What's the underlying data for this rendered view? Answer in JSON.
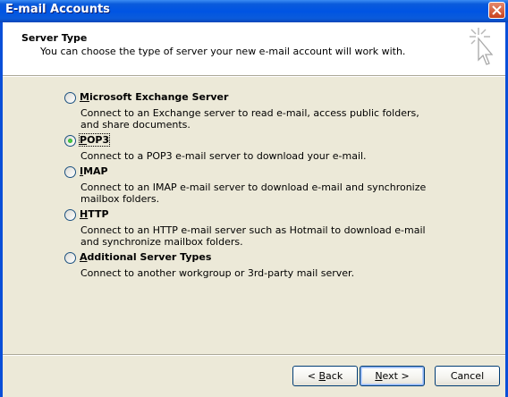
{
  "window": {
    "title": "E-mail Accounts"
  },
  "header": {
    "title": "Server Type",
    "subtitle": "You can choose the type of server your new e-mail account will work with."
  },
  "options": [
    {
      "label_first": "M",
      "label_rest": "icrosoft Exchange Server",
      "description": "Connect to an Exchange server to read e-mail, access public folders, and share documents.",
      "selected": false
    },
    {
      "label_first": "P",
      "label_rest": "OP3",
      "description": "Connect to a POP3 e-mail server to download your e-mail.",
      "selected": true
    },
    {
      "label_first": "I",
      "label_rest": "MAP",
      "description": "Connect to an IMAP e-mail server to download e-mail and synchronize mailbox folders.",
      "selected": false
    },
    {
      "label_first": "H",
      "label_rest": "TTP",
      "description": "Connect to an HTTP e-mail server such as Hotmail to download e-mail and synchronize mailbox folders.",
      "selected": false
    },
    {
      "label_first": "A",
      "label_rest": "dditional Server Types",
      "description": "Connect to another workgroup or 3rd-party mail server.",
      "selected": false
    }
  ],
  "buttons": {
    "back_prefix": "< ",
    "back_mnemonic": "B",
    "back_rest": "ack",
    "next_mnemonic": "N",
    "next_rest": "ext >",
    "cancel": "Cancel"
  },
  "icons": {
    "close": "close-icon",
    "wizard": "cursor-sparkle-icon"
  },
  "colors": {
    "titlebar": "#0054E3",
    "dialog_bg": "#ECE9D8",
    "close": "#C8411D",
    "radio_dot": "#21A121"
  }
}
